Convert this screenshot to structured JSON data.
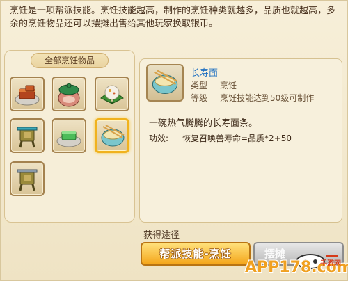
{
  "description": "烹饪是一项帮派技能。烹饪技能越高，制作的烹饪种类就越多，品质也就越高，多余的烹饪物品还可以摆摊出售给其他玩家换取银币。",
  "left_panel": {
    "title": "全部烹饪物品",
    "items": [
      {
        "icon": "braised-pork-icon"
      },
      {
        "icon": "gourd-jar-icon"
      },
      {
        "icon": "rice-ball-icon"
      },
      {
        "icon": "bronze-vessel-icon"
      },
      {
        "icon": "green-tofu-icon"
      },
      {
        "icon": "longevity-noodles-icon",
        "selected": true
      },
      {
        "icon": "bronze-tripod-icon"
      }
    ]
  },
  "detail": {
    "name": "长寿面",
    "type_label": "类型",
    "type_value": "烹饪",
    "level_label": "等级",
    "level_value": "烹饪技能达到50级可制作",
    "description": "一碗热气腾腾的长寿面条。",
    "effect_label": "功效:",
    "effect_value": "恢复召唤兽寿命=品质*2+50"
  },
  "source": {
    "title": "获得途径",
    "primary_button": "帮派技能-烹饪",
    "secondary_button": "摆摊"
  },
  "watermark": {
    "text": "APP178.com",
    "sub": "手游网"
  },
  "colors": {
    "item_name": "#1e6fc1",
    "primary_button": "#f4a51a",
    "selected_border": "#f0b21e"
  }
}
